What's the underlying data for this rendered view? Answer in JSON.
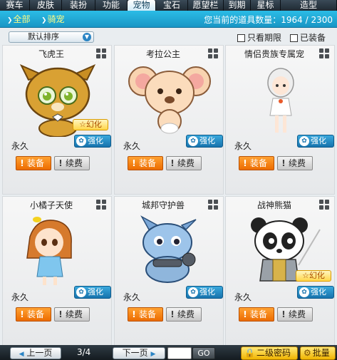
{
  "tabs": [
    "赛车",
    "皮肤",
    "装扮",
    "功能",
    "宠物",
    "宝石",
    "愿望栏",
    "到期",
    "星标",
    "造型"
  ],
  "active_tab": "宠物",
  "subnav": {
    "all": "全部",
    "ride": "骑宠"
  },
  "count": {
    "label": "您当前的道具数量：",
    "value": "1964 / 2300"
  },
  "sort": {
    "value": "默认排序"
  },
  "filters": {
    "expiry_only": "只看期限",
    "equipped": "已装备"
  },
  "cards": [
    {
      "name": "飞虎王",
      "huanhua": "幻化",
      "duration": "永久",
      "enhance": "强化",
      "equip": "装备",
      "renew": "续费",
      "pet": "flying-tiger",
      "has_huanhua": true
    },
    {
      "name": "考拉公主",
      "duration": "永久",
      "enhance": "强化",
      "equip": "装备",
      "renew": "续费",
      "pet": "koala",
      "has_huanhua": false
    },
    {
      "name": "情侣贵族专属宠",
      "duration": "永久",
      "enhance": "强化",
      "equip": "装备",
      "renew": "续费",
      "pet": "doll",
      "has_huanhua": false
    },
    {
      "name": "小橘子天使",
      "duration": "永久",
      "enhance": "强化",
      "equip": "装备",
      "renew": "续费",
      "pet": "angel-girl",
      "has_huanhua": false
    },
    {
      "name": "城邦守护兽",
      "duration": "永久",
      "enhance": "强化",
      "equip": "装备",
      "renew": "续费",
      "pet": "dragon",
      "has_huanhua": false
    },
    {
      "name": "战神熊猫",
      "huanhua": "幻化",
      "duration": "永久",
      "enhance": "强化",
      "equip": "装备",
      "renew": "续费",
      "pet": "panda",
      "has_huanhua": true
    }
  ],
  "pagination": {
    "prev": "上一页",
    "next": "下一页",
    "current": "3/4",
    "go": "GO",
    "page_input": ""
  },
  "bottom": {
    "password": "二级密码",
    "batch": "批量"
  },
  "colors": {
    "tab_bg": "#1f2a33",
    "subbar": "#1996c5",
    "equip_orange": "#ec6c00",
    "enhance_blue": "#1773ad",
    "gold": "#f0b400"
  }
}
